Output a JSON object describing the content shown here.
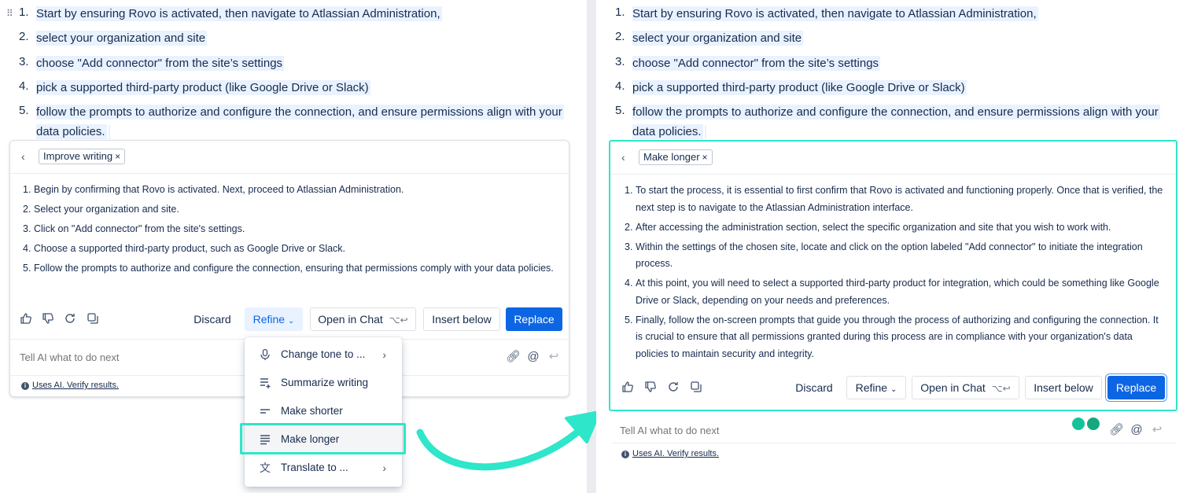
{
  "colors": {
    "highlight": "#2ee6c9",
    "primary": "#0c66e4",
    "selection": "#e9f2ff"
  },
  "document": {
    "steps": [
      "Start by ensuring Rovo is activated, then navigate to Atlassian Administration,",
      "select your organization and site",
      "choose \"Add connector\" from the site’s settings",
      "pick a supported third-party product (like Google Drive or Slack)",
      "follow the prompts to authorize and configure the connection, and ensure permissions align with your data policies."
    ],
    "numbers": [
      "1.",
      "2.",
      "3.",
      "4.",
      "5."
    ]
  },
  "left_card": {
    "chip_label": "Improve writing",
    "chip_close": "×",
    "result_numbers": [
      "1.",
      "2.",
      "3.",
      "4.",
      "5."
    ],
    "result": [
      "Begin by confirming that Rovo is activated. Next, proceed to Atlassian Administration.",
      "Select your organization and site.",
      "Click on \"Add connector\" from the site's settings.",
      "Choose a supported third-party product, such as Google Drive or Slack.",
      "Follow the prompts to authorize and configure the connection, ensuring that permissions comply with your data policies."
    ],
    "discard": "Discard",
    "refine": "Refine",
    "open_in_chat": "Open in Chat",
    "shortcut": "⌥↩",
    "insert_below": "Insert below",
    "replace": "Replace",
    "prompt_placeholder": "Tell AI what to do next",
    "disclaimer": "Uses AI. Verify results."
  },
  "refine_menu": {
    "items": [
      {
        "label": "Change tone to ...",
        "icon": "microphone-icon",
        "has_submenu": true
      },
      {
        "label": "Summarize writing",
        "icon": "summarize-icon",
        "has_submenu": false
      },
      {
        "label": "Make shorter",
        "icon": "shorter-icon",
        "has_submenu": false
      },
      {
        "label": "Make longer",
        "icon": "longer-icon",
        "has_submenu": false,
        "highlighted": true
      },
      {
        "label": "Translate to ...",
        "icon": "translate-icon",
        "has_submenu": true
      }
    ]
  },
  "right_card": {
    "chip_label": "Make longer",
    "chip_close": "×",
    "result_numbers": [
      "1.",
      "2.",
      "3.",
      "4.",
      "5."
    ],
    "result": [
      "To start the process, it is essential to first confirm that Rovo is activated and functioning properly. Once that is verified, the next step is to navigate to the Atlassian Administration interface.",
      "After accessing the administration section, select the specific organization and site that you wish to work with.",
      "Within the settings of the chosen site, locate and click on the option labeled \"Add connector\" to initiate the integration process.",
      "At this point, you will need to select a supported third-party product for integration, which could be something like Google Drive or Slack, depending on your needs and preferences.",
      "Finally, follow the on-screen prompts that guide you through the process of authorizing and configuring the connection. It is crucial to ensure that all permissions granted during this process are in compliance with your organization's data policies to maintain security and integrity."
    ],
    "discard": "Discard",
    "refine": "Refine",
    "open_in_chat": "Open in Chat",
    "shortcut": "⌥↩",
    "insert_below": "Insert below",
    "replace": "Replace",
    "prompt_placeholder": "Tell AI what to do next",
    "disclaimer": "Uses AI. Verify results."
  }
}
